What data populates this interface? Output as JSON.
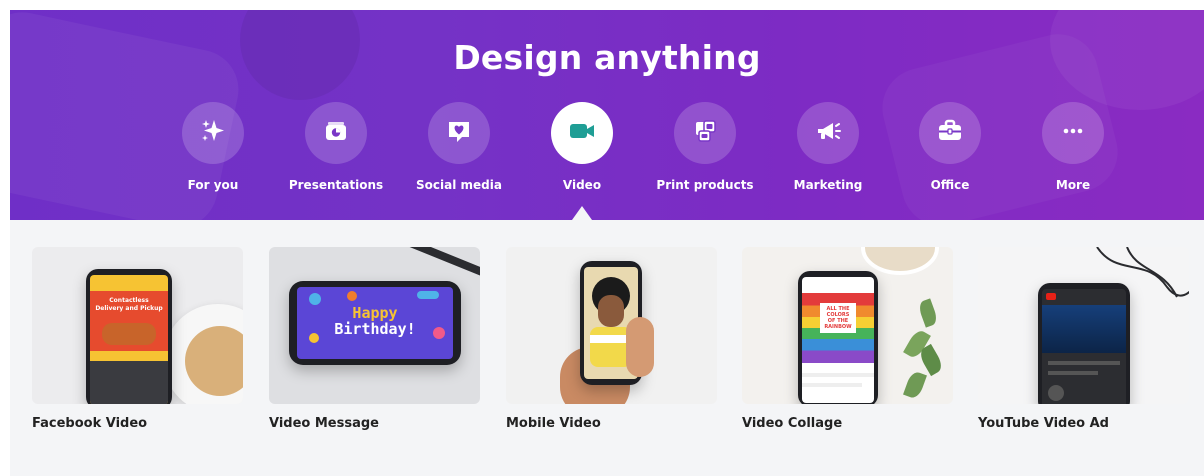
{
  "hero": {
    "title": "Design anything"
  },
  "categories": [
    {
      "label": "For you",
      "icon": "sparkle-icon",
      "active": false
    },
    {
      "label": "Presentations",
      "icon": "presentation-icon",
      "active": false
    },
    {
      "label": "Social media",
      "icon": "heart-chat-icon",
      "active": false
    },
    {
      "label": "Video",
      "icon": "video-camera-icon",
      "active": true
    },
    {
      "label": "Print products",
      "icon": "print-cards-icon",
      "active": false
    },
    {
      "label": "Marketing",
      "icon": "megaphone-icon",
      "active": false
    },
    {
      "label": "Office",
      "icon": "briefcase-icon",
      "active": false
    },
    {
      "label": "More",
      "icon": "more-dots-icon",
      "active": false
    }
  ],
  "cards": [
    {
      "label": "Facebook Video",
      "thumb": {
        "lines": [
          "Contactless",
          "Delivery and Pickup"
        ]
      }
    },
    {
      "label": "Video Message",
      "thumb": {
        "lines": [
          "Happy",
          "Birthday!"
        ]
      }
    },
    {
      "label": "Mobile Video"
    },
    {
      "label": "Video Collage",
      "thumb": {
        "lines": [
          "ALL THE",
          "COLORS",
          "OF THE",
          "RAINBOW"
        ]
      }
    },
    {
      "label": "YouTube Video Ad"
    }
  ],
  "colors": {
    "hero_bg": "#7432c6",
    "active_icon": "#1f9e95",
    "content_bg": "#f4f5f7"
  }
}
